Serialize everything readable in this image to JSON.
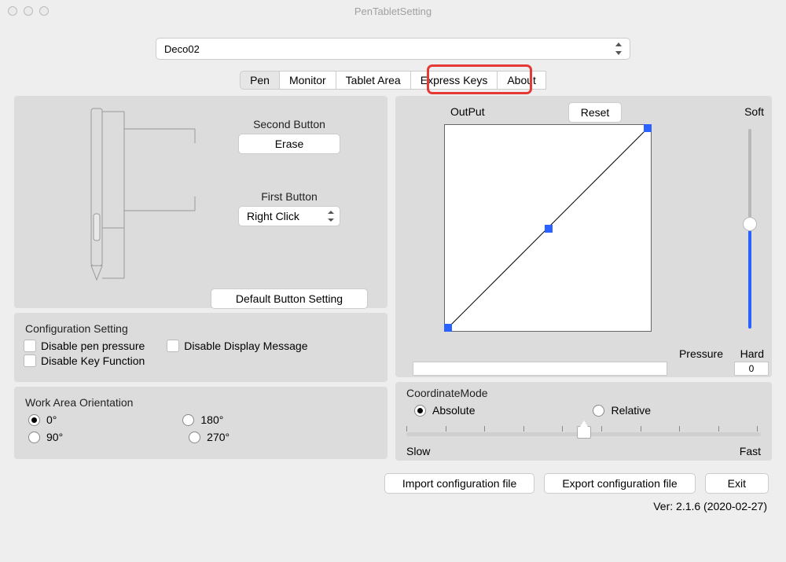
{
  "window": {
    "title": "PenTabletSetting"
  },
  "device": {
    "selected": "Deco02"
  },
  "tabs": [
    "Pen",
    "Monitor",
    "Tablet Area",
    "Express Keys",
    "About"
  ],
  "pen": {
    "second_button_title": "Second Button",
    "second_button_value": "Erase",
    "first_button_title": "First Button",
    "first_button_value": "Right Click",
    "default_button_label": "Default  Button Setting"
  },
  "config": {
    "title": "Configuration Setting",
    "disable_pressure": "Disable pen pressure",
    "disable_display_msg": "Disable Display Message",
    "disable_key_fn": "Disable Key Function"
  },
  "orientation": {
    "title": "Work Area Orientation",
    "opt0": "0°",
    "opt180": "180°",
    "opt90": "90°",
    "opt270": "270°"
  },
  "curve": {
    "output": "OutPut",
    "reset": "Reset",
    "soft": "Soft",
    "hard": "Hard",
    "pressure": "Pressure",
    "pressure_value": "0"
  },
  "coord": {
    "title": "CoordinateMode",
    "absolute": "Absolute",
    "relative": "Relative",
    "slow": "Slow",
    "fast": "Fast"
  },
  "buttons": {
    "import": "Import configuration file",
    "export": "Export configuration file",
    "exit": "Exit"
  },
  "version": "Ver: 2.1.6 (2020-02-27)"
}
